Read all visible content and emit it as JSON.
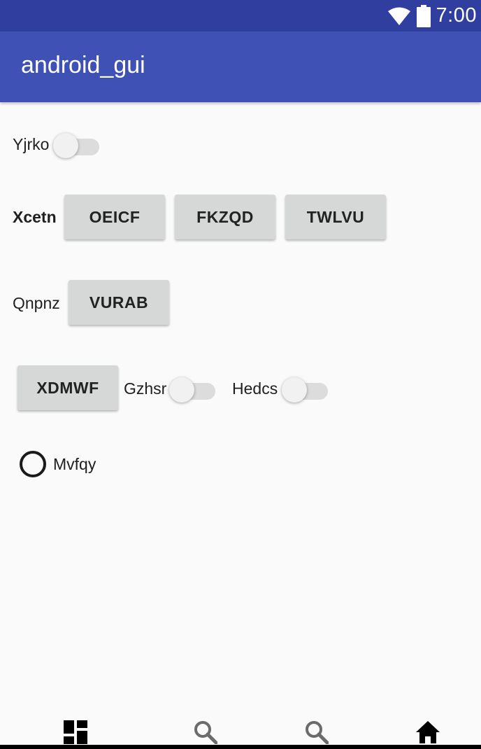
{
  "status_bar": {
    "time": "7:00",
    "wifi_icon": "wifi-icon",
    "battery_icon": "battery-icon",
    "background": "#303f9f"
  },
  "app_bar": {
    "title": "android_gui",
    "background": "#3f51b5"
  },
  "rows": {
    "row1": {
      "label": "Yjrko",
      "switch_on": false
    },
    "row2": {
      "label": "Xcetn",
      "buttons": [
        "OEICF",
        "FKZQD",
        "TWLVU"
      ]
    },
    "row3": {
      "label": "Qnpnz",
      "button": "VURAB"
    },
    "row4": {
      "button": "XDMWF",
      "switch1_label": "Gzhsr",
      "switch1_on": false,
      "switch2_label": "Hedcs",
      "switch2_on": false
    },
    "row5": {
      "radio_label": "Mvfqy",
      "radio_checked": false
    }
  },
  "bottom_nav": {
    "items": [
      {
        "icon": "dashboard-icon"
      },
      {
        "icon": "search-icon"
      },
      {
        "icon": "search-icon"
      },
      {
        "icon": "home-icon"
      }
    ]
  }
}
